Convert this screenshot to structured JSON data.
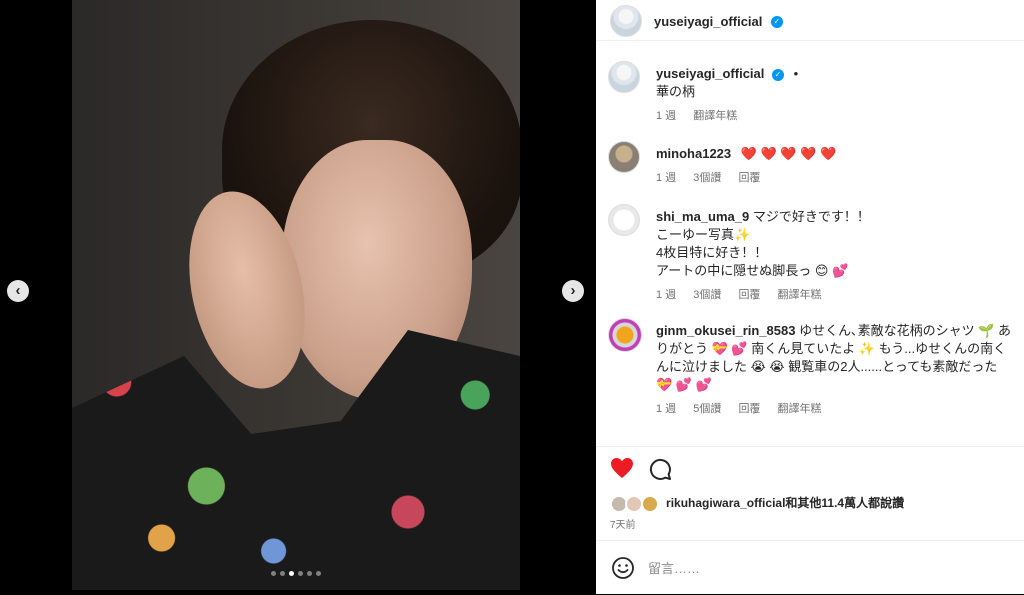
{
  "post": {
    "username": "yuseiyagi_official",
    "caption": "華の柄",
    "caption_meta": {
      "time": "1 週",
      "translate": "翻譯年糕"
    },
    "separator": "•"
  },
  "comments": [
    {
      "username": "minoha1223",
      "text": "❤️ ❤️ ❤️ ❤️ ❤️",
      "meta": {
        "time": "1 週",
        "likes": "3個讚",
        "reply": "回覆"
      }
    },
    {
      "username": "shi_ma_uma_9",
      "text": "マジで好きです！！\nこーゆー写真✨\n4枚目特に好き！！\nアートの中に隠せぬ脚長っ 😊 💕",
      "meta": {
        "time": "1 週",
        "likes": "3個讚",
        "reply": "回覆",
        "translate": "翻譯年糕"
      }
    },
    {
      "username": "ginm_okusei_rin_8583",
      "text": "ゆせくん､素敵な花柄のシャツ 🌱 ありがとう 💝 💕 南くん見ていたよ ✨ もう...ゆせくんの南くんに泣けました 😭 😭 観覧車の2人......とっても素敵だった 💝 💕 💕",
      "meta": {
        "time": "1 週",
        "likes": "5個讚",
        "reply": "回覆",
        "translate": "翻譯年糕"
      }
    }
  ],
  "likes": {
    "by": "rikuhagiwara_official",
    "summary": "和其他11.4萬人都說讚"
  },
  "posted": "7天前",
  "comment_input": {
    "placeholder": "留言……"
  },
  "icons": {
    "like": "heart-filled-icon",
    "comment": "comment-bubble-icon",
    "emoji": "emoji-smile-icon",
    "prev": "chevron-left-icon",
    "next": "chevron-right-icon",
    "verified": "verified-badge-icon"
  },
  "colors": {
    "like": "#ed1c24",
    "verified": "#0095f6",
    "meta_text": "#737373"
  },
  "carousel": {
    "total": 6,
    "active_index": 2
  }
}
